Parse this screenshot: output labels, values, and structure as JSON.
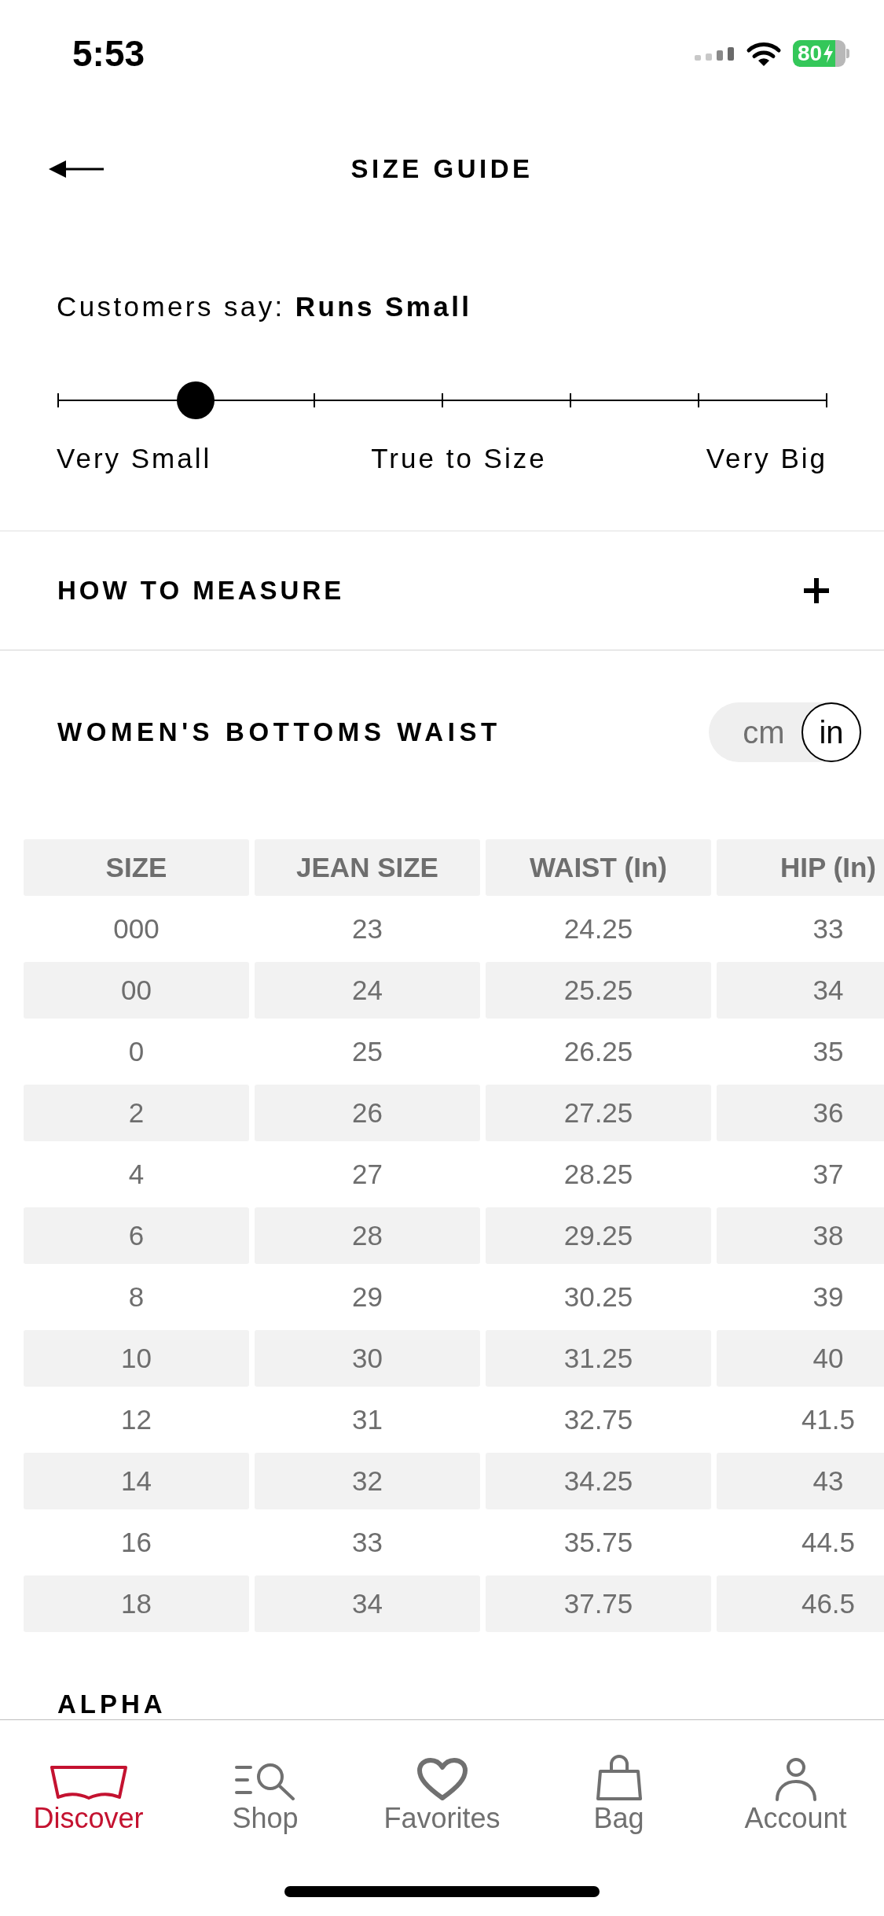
{
  "status_bar": {
    "time": "5:53",
    "battery": "80"
  },
  "header": {
    "title": "SIZE GUIDE"
  },
  "fit_rating": {
    "summary": "Customers say: **Runs Small**",
    "slider": {
      "level": 0.18
    },
    "scale_labels": [
      "Very Small",
      "True to Size",
      "Very Big"
    ]
  },
  "how_to_measure": {
    "title": "HOW TO MEASURE",
    "expanded": false
  },
  "size_chart": {
    "title": "WOMEN'S BOTTOMS WAIST",
    "units": [
      {
        "label": "cm",
        "selected": false
      },
      {
        "label": "in",
        "selected": true
      }
    ],
    "columns": [
      "SIZE",
      "JEAN SIZE",
      "WAIST (In)",
      "HIP (In)"
    ],
    "rows": [
      [
        "000",
        "23",
        "24.25",
        "33"
      ],
      [
        "00",
        "24",
        "25.25",
        "34"
      ],
      [
        "0",
        "25",
        "26.25",
        "35"
      ],
      [
        "2",
        "26",
        "27.25",
        "36"
      ],
      [
        "4",
        "27",
        "28.25",
        "37"
      ],
      [
        "6",
        "28",
        "29.25",
        "38"
      ],
      [
        "8",
        "29",
        "30.25",
        "39"
      ],
      [
        "10",
        "30",
        "31.25",
        "40"
      ],
      [
        "12",
        "31",
        "32.75",
        "41.5"
      ],
      [
        "14",
        "32",
        "34.25",
        "43"
      ],
      [
        "16",
        "33",
        "35.75",
        "44.5"
      ],
      [
        "18",
        "34",
        "37.75",
        "46.5"
      ]
    ]
  },
  "next_section": {
    "title": "ALPHA"
  },
  "tab_bar": {
    "tabs": [
      {
        "label": "Discover",
        "selected": true
      },
      {
        "label": "Shop",
        "selected": false
      },
      {
        "label": "Favorites",
        "selected": false
      },
      {
        "label": "Bag",
        "selected": false
      },
      {
        "label": "Account",
        "selected": false
      }
    ]
  }
}
